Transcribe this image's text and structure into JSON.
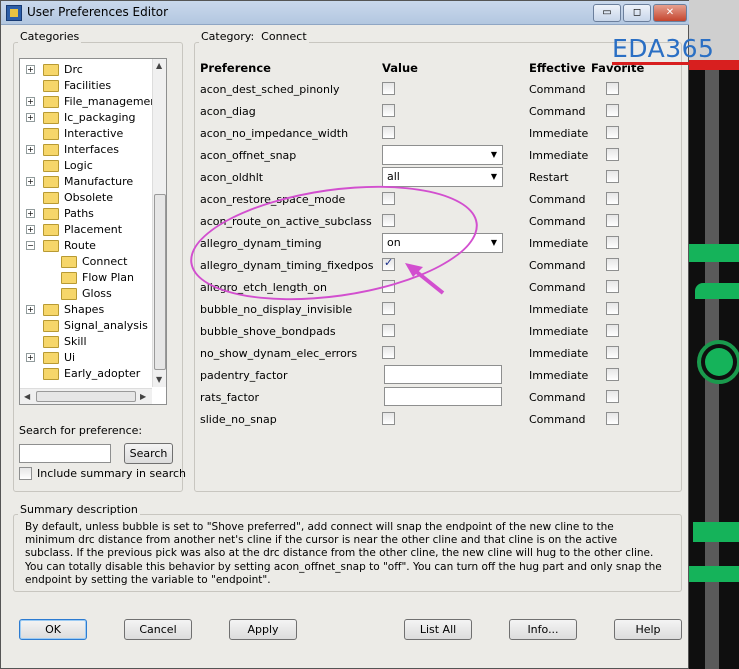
{
  "window": {
    "title": "User Preferences Editor",
    "min_label": "▭",
    "restore_label": "◻",
    "close_label": "✕"
  },
  "watermark": "EDA365",
  "categories": {
    "group_label": "Categories",
    "items": [
      {
        "label": "Drc",
        "expander": "+",
        "level": 0
      },
      {
        "label": "Facilities",
        "expander": "",
        "level": 0
      },
      {
        "label": "File_management",
        "expander": "+",
        "level": 0
      },
      {
        "label": "Ic_packaging",
        "expander": "+",
        "level": 0
      },
      {
        "label": "Interactive",
        "expander": "",
        "level": 0
      },
      {
        "label": "Interfaces",
        "expander": "+",
        "level": 0
      },
      {
        "label": "Logic",
        "expander": "",
        "level": 0
      },
      {
        "label": "Manufacture",
        "expander": "+",
        "level": 0
      },
      {
        "label": "Obsolete",
        "expander": "",
        "level": 0
      },
      {
        "label": "Paths",
        "expander": "+",
        "level": 0
      },
      {
        "label": "Placement",
        "expander": "+",
        "level": 0
      },
      {
        "label": "Route",
        "expander": "−",
        "level": 0
      },
      {
        "label": "Connect",
        "expander": "",
        "level": 1
      },
      {
        "label": "Flow Plan",
        "expander": "",
        "level": 1
      },
      {
        "label": "Gloss",
        "expander": "",
        "level": 1
      },
      {
        "label": "Shapes",
        "expander": "+",
        "level": 0
      },
      {
        "label": "Signal_analysis",
        "expander": "",
        "level": 0
      },
      {
        "label": "Skill",
        "expander": "",
        "level": 0
      },
      {
        "label": "Ui",
        "expander": "+",
        "level": 0
      },
      {
        "label": "Early_adopter",
        "expander": "",
        "level": 0
      }
    ]
  },
  "search": {
    "label": "Search for preference:",
    "value": "",
    "button": "Search",
    "include_summary_label": "Include summary in search",
    "include_summary_checked": false
  },
  "category_panel": {
    "label": "Category:",
    "value": "Connect",
    "col_preference": "Preference",
    "col_value": "Value",
    "col_effective": "Effective",
    "col_favorite": "Favorite",
    "rows": [
      {
        "name": "acon_dest_sched_pinonly",
        "type": "checkbox",
        "checked": false,
        "effective": "Command"
      },
      {
        "name": "acon_diag",
        "type": "checkbox",
        "checked": false,
        "effective": "Command"
      },
      {
        "name": "acon_no_impedance_width",
        "type": "checkbox",
        "checked": false,
        "effective": "Immediate"
      },
      {
        "name": "acon_offnet_snap",
        "type": "combo",
        "value": "",
        "effective": "Immediate"
      },
      {
        "name": "acon_oldhlt",
        "type": "combo",
        "value": "all",
        "effective": "Restart"
      },
      {
        "name": "acon_restore_space_mode",
        "type": "checkbox",
        "checked": false,
        "effective": "Command"
      },
      {
        "name": "acon_route_on_active_subclass",
        "type": "checkbox",
        "checked": false,
        "effective": "Command"
      },
      {
        "name": "allegro_dynam_timing",
        "type": "combo",
        "value": "on",
        "effective": "Immediate"
      },
      {
        "name": "allegro_dynam_timing_fixedpos",
        "type": "checkbox",
        "checked": true,
        "effective": "Command"
      },
      {
        "name": "allegro_etch_length_on",
        "type": "checkbox",
        "checked": false,
        "effective": "Command"
      },
      {
        "name": "bubble_no_display_invisible",
        "type": "checkbox",
        "checked": false,
        "effective": "Immediate"
      },
      {
        "name": "bubble_shove_bondpads",
        "type": "checkbox",
        "checked": false,
        "effective": "Immediate"
      },
      {
        "name": "no_show_dynam_elec_errors",
        "type": "checkbox",
        "checked": false,
        "effective": "Immediate"
      },
      {
        "name": "padentry_factor",
        "type": "text",
        "value": "",
        "effective": "Immediate"
      },
      {
        "name": "rats_factor",
        "type": "text",
        "value": "",
        "effective": "Command"
      },
      {
        "name": "slide_no_snap",
        "type": "checkbox",
        "checked": false,
        "effective": "Command"
      }
    ]
  },
  "summary": {
    "label": "Summary description",
    "text": "By default, unless bubble is set to \"Shove preferred\", add connect will snap the endpoint of the new cline to the minimum drc distance from another net's cline if the cursor is near the other cline and that cline is on the active subclass. If the previous pick was also at the drc distance from the other cline, the new cline will hug to the other cline. You can totally disable this behavior by setting acon_offnet_snap to \"off\". You can turn off the hug part and only snap the endpoint by setting the variable to \"endpoint\"."
  },
  "buttons": {
    "ok": "OK",
    "cancel": "Cancel",
    "apply": "Apply",
    "list_all": "List All",
    "info": "Info...",
    "help": "Help"
  },
  "colors": {
    "highlight_ellipse": "#d24fcf",
    "watermark": "#2a6fc4"
  }
}
